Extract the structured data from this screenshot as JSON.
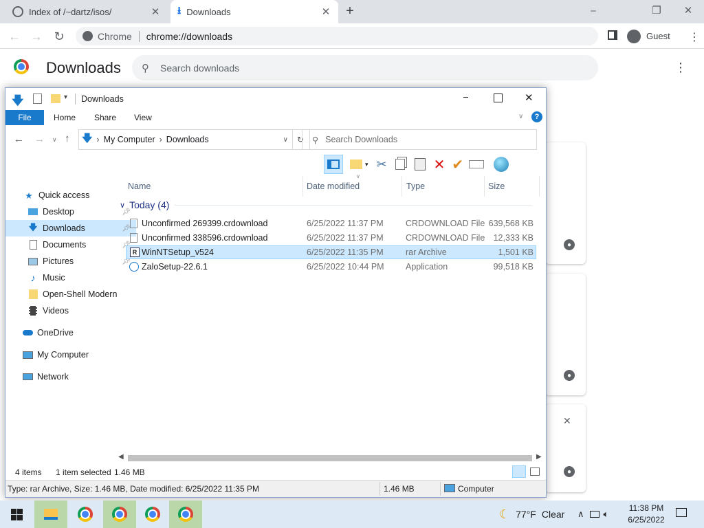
{
  "browser": {
    "tabs": [
      {
        "title": "Index of /~dartz/isos/",
        "icon": "site-icon"
      },
      {
        "title": "Downloads",
        "icon": "download-icon"
      }
    ],
    "omnibox": {
      "chip": "Chrome",
      "url": "chrome://downloads"
    },
    "profile_label": "Guest"
  },
  "downloads_page": {
    "title": "Downloads",
    "search_placeholder": "Search downloads"
  },
  "explorer": {
    "title": "Downloads",
    "ribbon_tabs": [
      "File",
      "Home",
      "Share",
      "View"
    ],
    "breadcrumb": [
      "My Computer",
      "Downloads"
    ],
    "search_placeholder": "Search Downloads",
    "nav": {
      "quick_access": "Quick access",
      "items": [
        "Desktop",
        "Downloads",
        "Documents",
        "Pictures",
        "Music",
        "Open-Shell Modern",
        "Videos"
      ],
      "onedrive": "OneDrive",
      "my_computer": "My Computer",
      "network": "Network"
    },
    "columns": [
      "Name",
      "Date modified",
      "Type",
      "Size"
    ],
    "group_label": "Today (4)",
    "files": [
      {
        "name": "Unconfirmed 269399.crdownload",
        "date": "6/25/2022 11:37 PM",
        "type": "CRDOWNLOAD File",
        "size": "639,568 KB"
      },
      {
        "name": "Unconfirmed 338596.crdownload",
        "date": "6/25/2022 11:37 PM",
        "type": "CRDOWNLOAD File",
        "size": "12,333 KB"
      },
      {
        "name": "WinNTSetup_v524",
        "date": "6/25/2022 11:35 PM",
        "type": "rar Archive",
        "size": "1,501 KB"
      },
      {
        "name": "ZaloSetup-22.6.1",
        "date": "6/25/2022 10:44 PM",
        "type": "Application",
        "size": "99,518 KB"
      }
    ],
    "status": {
      "count": "4 items",
      "selected": "1 item selected",
      "sel_size": "1.46 MB"
    },
    "details": {
      "text": "Type: rar Archive, Size: 1.46 MB, Date modified: 6/25/2022 11:35 PM",
      "size": "1.46 MB",
      "location": "Computer"
    }
  },
  "taskbar": {
    "weather_temp": "77°F",
    "weather_desc": "Clear",
    "time": "11:38 PM",
    "date": "6/25/2022"
  },
  "colors": {
    "accent": "#1a73e8",
    "explorer_file_tab": "#1979ca",
    "selection": "#cce8ff"
  }
}
